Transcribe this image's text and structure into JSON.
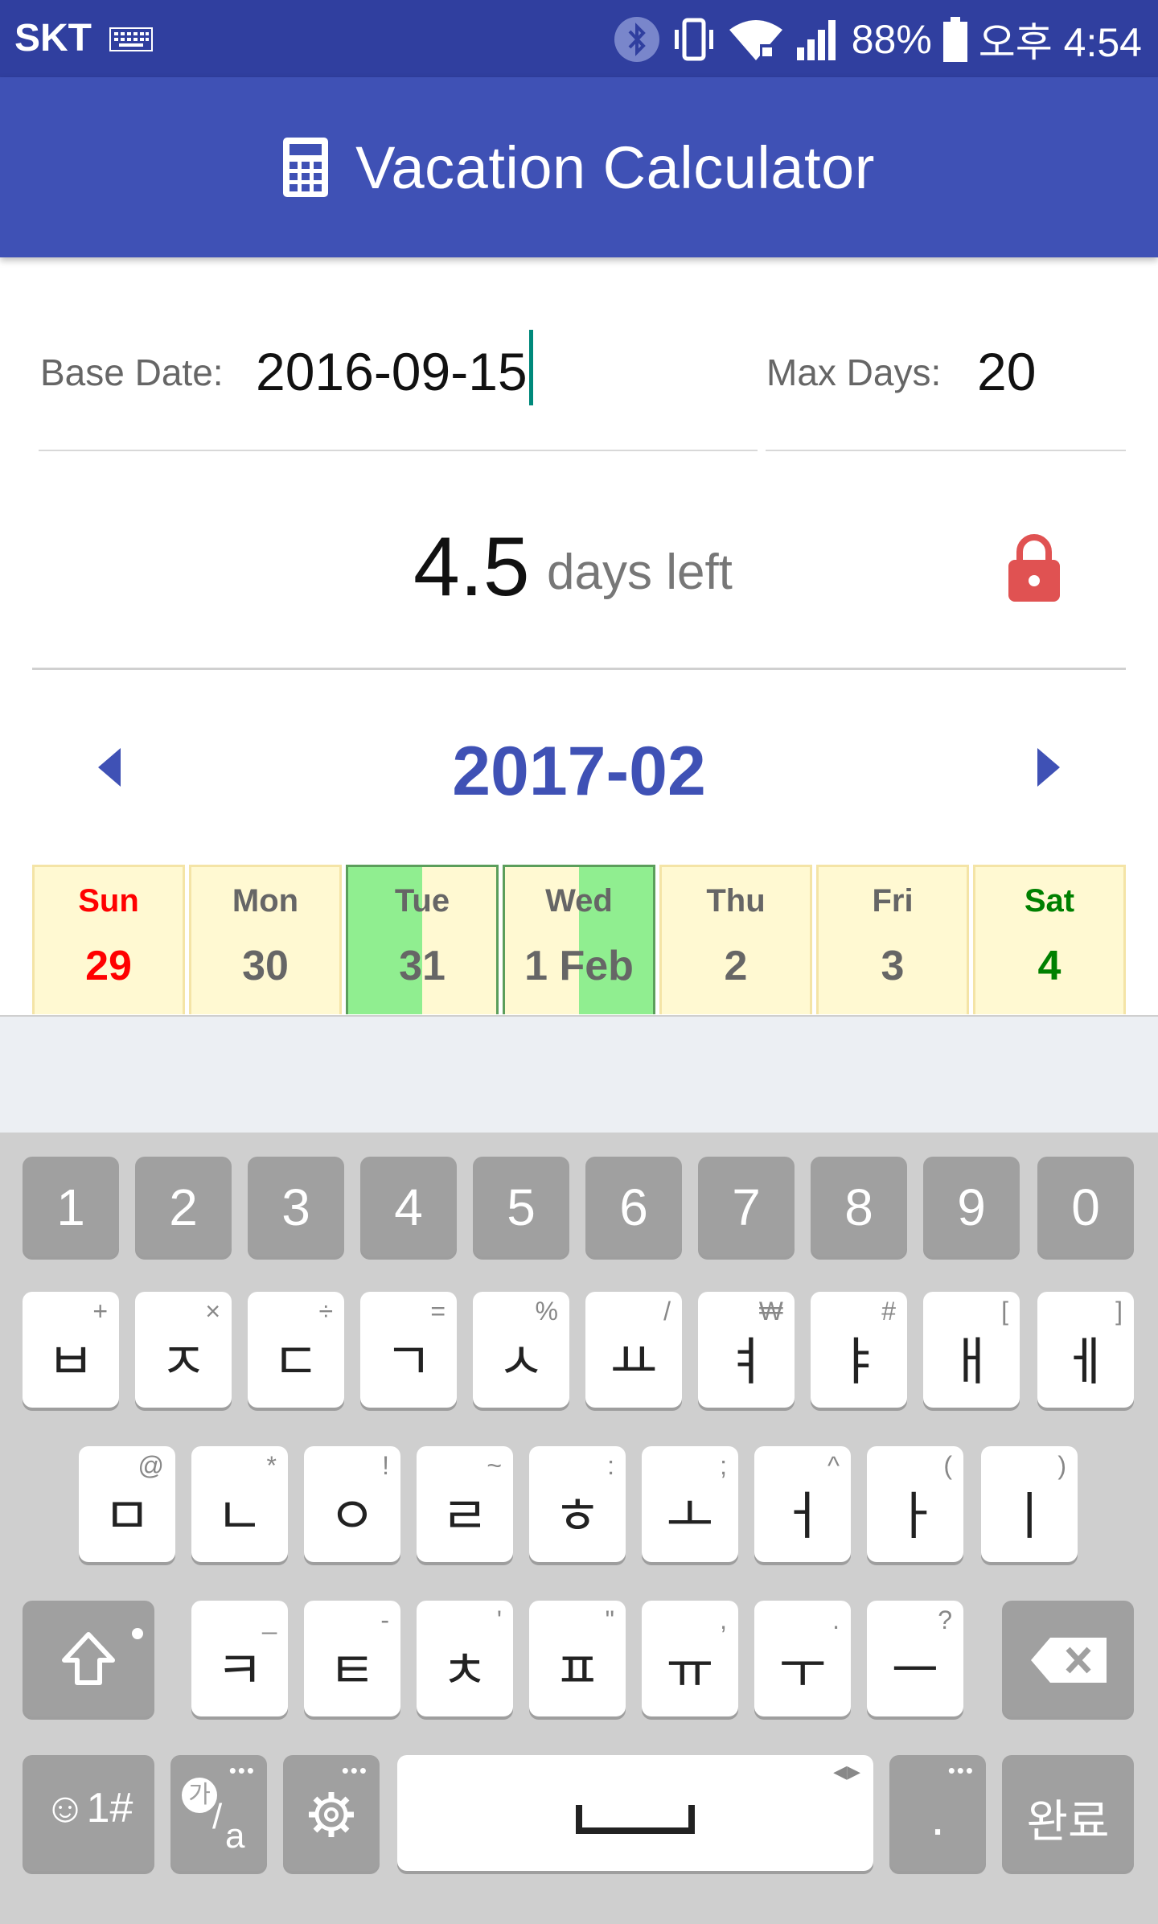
{
  "status_bar": {
    "carrier": "SKT",
    "battery": "88%",
    "time": "오후 4:54",
    "icons": [
      "keyboard-icon",
      "bluetooth-icon",
      "vibrate-icon",
      "wifi-icon",
      "signal-icon",
      "battery-icon"
    ]
  },
  "app_bar": {
    "title": "Vacation Calculator",
    "icon": "calculator-icon",
    "background": "#3f51b5"
  },
  "form": {
    "base_date_label": "Base Date:",
    "base_date_value": "2016-09-15",
    "max_days_label": "Max Days:",
    "max_days_value": "20"
  },
  "summary": {
    "days_value": "4.5",
    "days_text": "days left",
    "lock_icon": "lock-icon",
    "lock_color": "#e05252"
  },
  "calendar": {
    "month": "2017-02",
    "prev_icon": "chevron-left-icon",
    "next_icon": "chevron-right-icon",
    "days": [
      {
        "name": "Sun",
        "date": "29"
      },
      {
        "name": "Mon",
        "date": "30"
      },
      {
        "name": "Tue",
        "date": "31"
      },
      {
        "name": "Wed",
        "date": "1 Feb"
      },
      {
        "name": "Thu",
        "date": "2"
      },
      {
        "name": "Fri",
        "date": "3"
      },
      {
        "name": "Sat",
        "date": "4"
      }
    ],
    "colors": {
      "weekend_sun": "#ff0000",
      "weekend_sat": "#008000",
      "cell_bg": "#fff9d2",
      "vacation": "#90ee90"
    }
  },
  "keyboard": {
    "number_row": [
      "1",
      "2",
      "3",
      "4",
      "5",
      "6",
      "7",
      "8",
      "9",
      "0"
    ],
    "row1": [
      {
        "key": "ㅂ",
        "sub": "+"
      },
      {
        "key": "ㅈ",
        "sub": "×"
      },
      {
        "key": "ㄷ",
        "sub": "÷"
      },
      {
        "key": "ㄱ",
        "sub": "="
      },
      {
        "key": "ㅅ",
        "sub": "%"
      },
      {
        "key": "ㅛ",
        "sub": "/"
      },
      {
        "key": "ㅕ",
        "sub": "₩"
      },
      {
        "key": "ㅑ",
        "sub": "#"
      },
      {
        "key": "ㅐ",
        "sub": "["
      },
      {
        "key": "ㅔ",
        "sub": "]"
      }
    ],
    "row2": [
      {
        "key": "ㅁ",
        "sub": "@"
      },
      {
        "key": "ㄴ",
        "sub": "*"
      },
      {
        "key": "ㅇ",
        "sub": "!"
      },
      {
        "key": "ㄹ",
        "sub": "~"
      },
      {
        "key": "ㅎ",
        "sub": ":"
      },
      {
        "key": "ㅗ",
        "sub": ";"
      },
      {
        "key": "ㅓ",
        "sub": "^"
      },
      {
        "key": "ㅏ",
        "sub": "("
      },
      {
        "key": "ㅣ",
        "sub": ")"
      }
    ],
    "row3": [
      {
        "key": "ㅋ",
        "sub": "_"
      },
      {
        "key": "ㅌ",
        "sub": "-"
      },
      {
        "key": "ㅊ",
        "sub": "'"
      },
      {
        "key": "ㅍ",
        "sub": "\""
      },
      {
        "key": "ㅠ",
        "sub": ","
      },
      {
        "key": "ㅜ",
        "sub": "."
      },
      {
        "key": "ㅡ",
        "sub": "?"
      }
    ],
    "emoji_label": "☺1#",
    "lang_label_top": "가",
    "lang_label_bottom": "a",
    "period_label": ".",
    "done_label": "완료"
  }
}
